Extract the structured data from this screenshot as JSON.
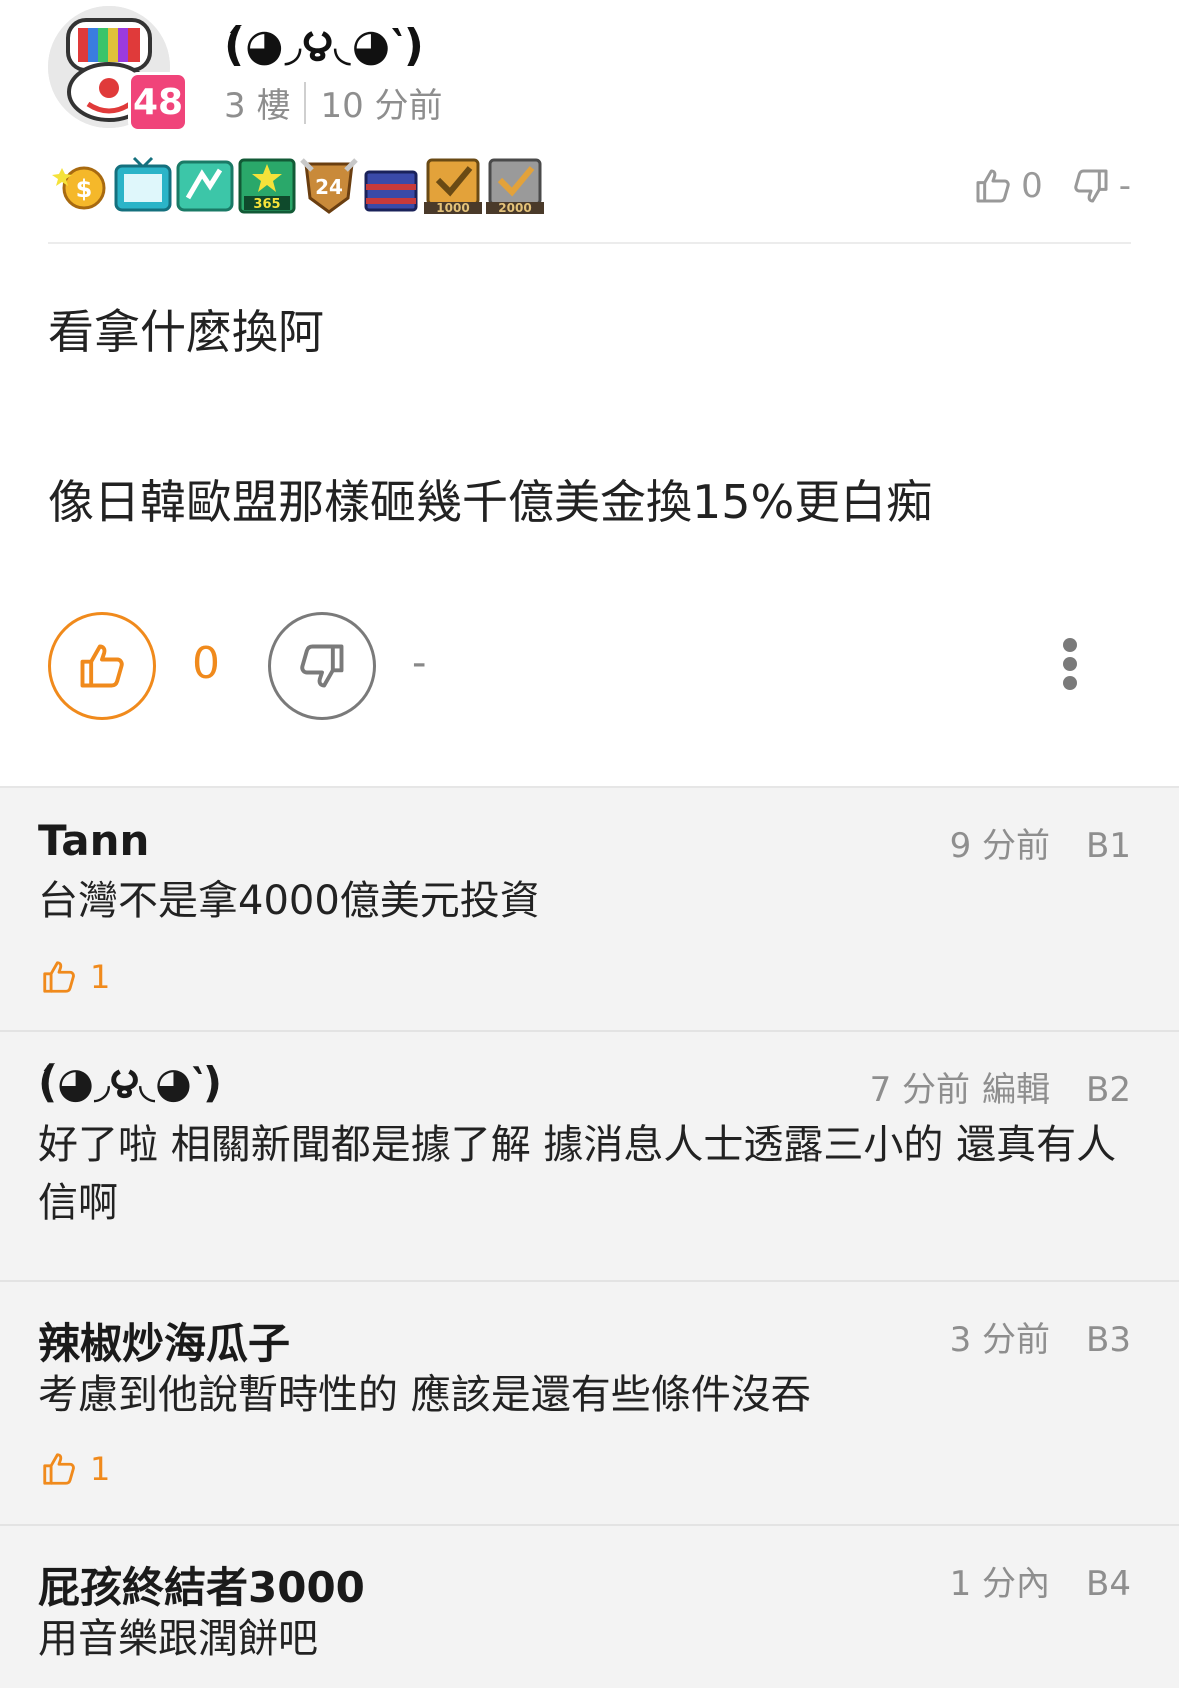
{
  "post": {
    "author": "(́◕◞౪◟◕‵)",
    "level": "48",
    "floor": "3 樓",
    "time": "10 分前",
    "like_count": "0",
    "dislike_count": "-",
    "body_lines": [
      "看拿什麼換阿",
      "像日韓歐盟那樣砸幾千億美金換15%更白痴"
    ],
    "medal_labels": [
      "365",
      "24",
      "1000",
      "2000"
    ],
    "big_like_count": "0",
    "big_dislike_count": "-"
  },
  "comments": [
    {
      "author": "Tann",
      "time": "9 分前",
      "edit": "",
      "floor": "B1",
      "text": "台灣不是拿4000億美元投資",
      "likes": "1"
    },
    {
      "author": "(́◕◞౪◟◕‵)",
      "time": "7 分前",
      "edit": "編輯",
      "floor": "B2",
      "text": "好了啦 相關新聞都是據了解 據消息人士透露三小的 還真有人信啊",
      "likes": ""
    },
    {
      "author": "辣椒炒海瓜子",
      "time": "3 分前",
      "edit": "",
      "floor": "B3",
      "text": "考慮到他說暫時性的 應該是還有些條件沒吞",
      "likes": "1"
    },
    {
      "author": "屁孩終結者3000",
      "time": "1 分內",
      "edit": "",
      "floor": "B4",
      "text": "用音樂跟潤餅吧",
      "likes": ""
    }
  ],
  "colors": {
    "accent": "#f08a1c",
    "level_badge": "#f0447a",
    "meta_gray": "#8e8e8e",
    "comments_bg": "#f3f3f3"
  },
  "icons": [
    "thumbs-up-icon",
    "thumbs-down-icon",
    "more-vertical-icon"
  ]
}
